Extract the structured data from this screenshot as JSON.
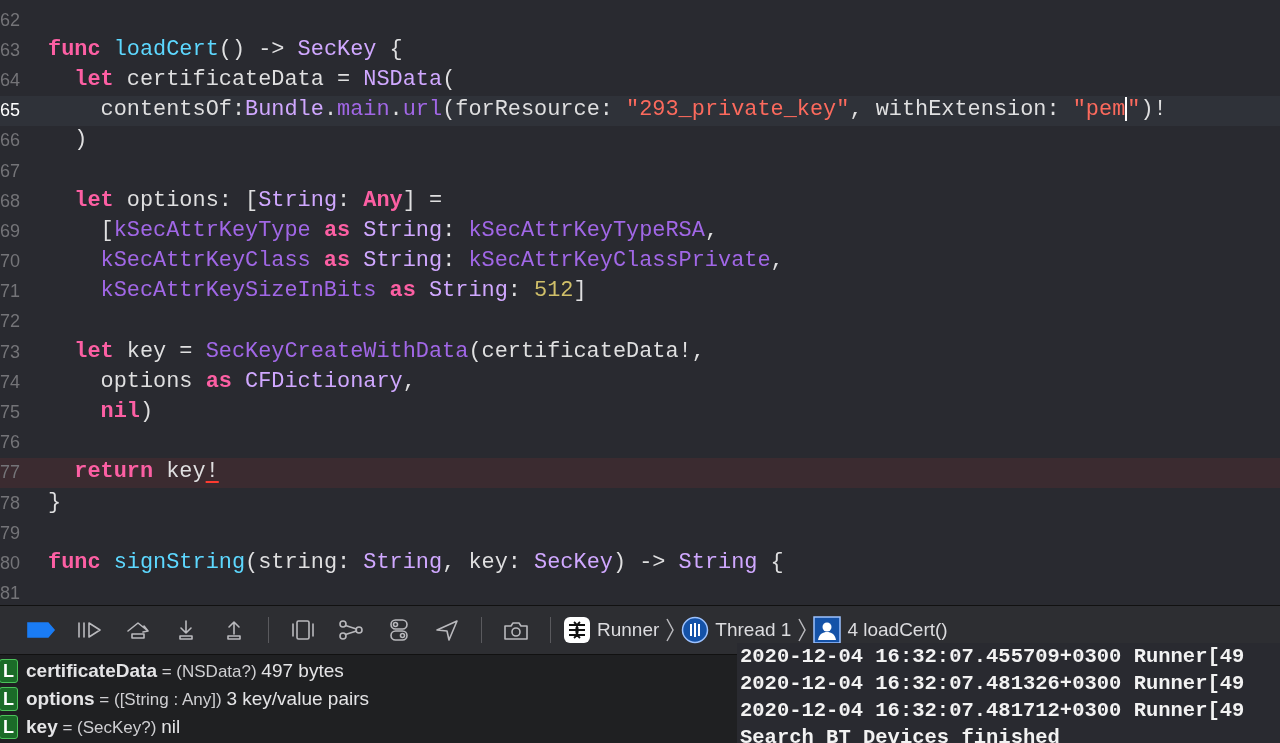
{
  "editor": {
    "lines": [
      {
        "number": "62",
        "current": false,
        "error": false
      },
      {
        "number": "63",
        "current": false,
        "error": false,
        "tokens": [
          {
            "text": "func",
            "kind": "keyword"
          },
          {
            "text": " loadCert",
            "kind": "decl"
          },
          {
            "text": "() -> ",
            "kind": "plain"
          },
          {
            "text": "SecKey",
            "kind": "type"
          },
          {
            "text": " {",
            "kind": "plain"
          }
        ]
      },
      {
        "number": "64",
        "current": false,
        "error": false,
        "tokens": [
          {
            "text": "  let",
            "kind": "keyword"
          },
          {
            "text": " certificateData = ",
            "kind": "plain"
          },
          {
            "text": "NSData",
            "kind": "type"
          },
          {
            "text": "(",
            "kind": "plain"
          }
        ]
      },
      {
        "number": "65",
        "current": true,
        "error": false,
        "tokens": [
          {
            "text": "    contentsOf:",
            "kind": "plain"
          },
          {
            "text": "Bundle",
            "kind": "type"
          },
          {
            "text": ".",
            "kind": "plain"
          },
          {
            "text": "main",
            "kind": "member"
          },
          {
            "text": ".",
            "kind": "plain"
          },
          {
            "text": "url",
            "kind": "member"
          },
          {
            "text": "(forResource: ",
            "kind": "plain"
          },
          {
            "text": "\"293_private_key\"",
            "kind": "string"
          },
          {
            "text": ", withExtension: ",
            "kind": "plain"
          },
          {
            "text": "\"pem",
            "kind": "string"
          },
          {
            "kind": "cursor"
          },
          {
            "text": "\"",
            "kind": "string"
          },
          {
            "text": ")!",
            "kind": "plain"
          }
        ]
      },
      {
        "number": "66",
        "current": false,
        "error": false,
        "tokens": [
          {
            "text": "  )",
            "kind": "plain"
          }
        ]
      },
      {
        "number": "67",
        "current": false,
        "error": false
      },
      {
        "number": "68",
        "current": false,
        "error": false,
        "tokens": [
          {
            "text": "  let",
            "kind": "keyword"
          },
          {
            "text": " options: [",
            "kind": "plain"
          },
          {
            "text": "String",
            "kind": "type"
          },
          {
            "text": ": ",
            "kind": "plain"
          },
          {
            "text": "Any",
            "kind": "keyword"
          },
          {
            "text": "] =",
            "kind": "plain"
          }
        ]
      },
      {
        "number": "69",
        "current": false,
        "error": false,
        "tokens": [
          {
            "text": "    [",
            "kind": "plain"
          },
          {
            "text": "kSecAttrKeyType",
            "kind": "member"
          },
          {
            "text": " as",
            "kind": "keyword"
          },
          {
            "text": " String",
            "kind": "type"
          },
          {
            "text": ": ",
            "kind": "plain"
          },
          {
            "text": "kSecAttrKeyTypeRSA",
            "kind": "member"
          },
          {
            "text": ",",
            "kind": "plain"
          }
        ]
      },
      {
        "number": "70",
        "current": false,
        "error": false,
        "tokens": [
          {
            "text": "    kSecAttrKeyClass",
            "kind": "member"
          },
          {
            "text": " as",
            "kind": "keyword"
          },
          {
            "text": " String",
            "kind": "type"
          },
          {
            "text": ": ",
            "kind": "plain"
          },
          {
            "text": "kSecAttrKeyClassPrivate",
            "kind": "member"
          },
          {
            "text": ",",
            "kind": "plain"
          }
        ]
      },
      {
        "number": "71",
        "current": false,
        "error": false,
        "tokens": [
          {
            "text": "    kSecAttrKeySizeInBits",
            "kind": "member"
          },
          {
            "text": " as",
            "kind": "keyword"
          },
          {
            "text": " String",
            "kind": "type"
          },
          {
            "text": ": ",
            "kind": "plain"
          },
          {
            "text": "512",
            "kind": "number"
          },
          {
            "text": "]",
            "kind": "plain"
          }
        ]
      },
      {
        "number": "72",
        "current": false,
        "error": false
      },
      {
        "number": "73",
        "current": false,
        "error": false,
        "tokens": [
          {
            "text": "  let",
            "kind": "keyword"
          },
          {
            "text": " key = ",
            "kind": "plain"
          },
          {
            "text": "SecKeyCreateWithData",
            "kind": "member"
          },
          {
            "text": "(certificateData!,",
            "kind": "plain"
          }
        ]
      },
      {
        "number": "74",
        "current": false,
        "error": false,
        "tokens": [
          {
            "text": "    options ",
            "kind": "plain"
          },
          {
            "text": "as",
            "kind": "keyword"
          },
          {
            "text": " CFDictionary",
            "kind": "type"
          },
          {
            "text": ",",
            "kind": "plain"
          }
        ]
      },
      {
        "number": "75",
        "current": false,
        "error": false,
        "tokens": [
          {
            "text": "    nil",
            "kind": "keyword"
          },
          {
            "text": ")",
            "kind": "plain"
          }
        ]
      },
      {
        "number": "76",
        "current": false,
        "error": false
      },
      {
        "number": "77",
        "current": false,
        "error": true,
        "tokens": [
          {
            "text": "  return",
            "kind": "keyword"
          },
          {
            "text": " key",
            "kind": "plain"
          },
          {
            "text": "!",
            "kind": "error"
          }
        ]
      },
      {
        "number": "78",
        "current": false,
        "error": false,
        "tokens": [
          {
            "text": "}",
            "kind": "plain"
          }
        ]
      },
      {
        "number": "79",
        "current": false,
        "error": false
      },
      {
        "number": "80",
        "current": false,
        "error": false,
        "tokens": [
          {
            "text": "func",
            "kind": "keyword"
          },
          {
            "text": " signString",
            "kind": "decl"
          },
          {
            "text": "(string: ",
            "kind": "plain"
          },
          {
            "text": "String",
            "kind": "type"
          },
          {
            "text": ", key: ",
            "kind": "plain"
          },
          {
            "text": "SecKey",
            "kind": "type"
          },
          {
            "text": ") -> ",
            "kind": "plain"
          },
          {
            "text": "String",
            "kind": "type"
          },
          {
            "text": " {",
            "kind": "plain"
          }
        ]
      },
      {
        "number": "81",
        "current": false,
        "error": false
      }
    ]
  },
  "debug_bar": {
    "breakpoints_active": true,
    "breadcrumb": [
      {
        "label": "Runner",
        "kind": "app"
      },
      {
        "label": "Thread 1",
        "kind": "thread"
      },
      {
        "label": "4 loadCert()",
        "kind": "frame"
      }
    ]
  },
  "variables": [
    {
      "scope": "L",
      "name": "certificateData",
      "operator": "=",
      "type": "(NSData?)",
      "value": "497 bytes"
    },
    {
      "scope": "L",
      "name": "options",
      "operator": "=",
      "type": "([String : Any])",
      "value": "3 key/value pairs"
    },
    {
      "scope": "L",
      "name": "key",
      "operator": "=",
      "type": "(SecKey?)",
      "value": "nil"
    }
  ],
  "console": {
    "lines": [
      "2020-12-04 16:32:07.455709+0300 Runner[49",
      "2020-12-04 16:32:07.481326+0300 Runner[49",
      "2020-12-04 16:32:07.481712+0300 Runner[49",
      "Search BT Devices finished"
    ]
  }
}
